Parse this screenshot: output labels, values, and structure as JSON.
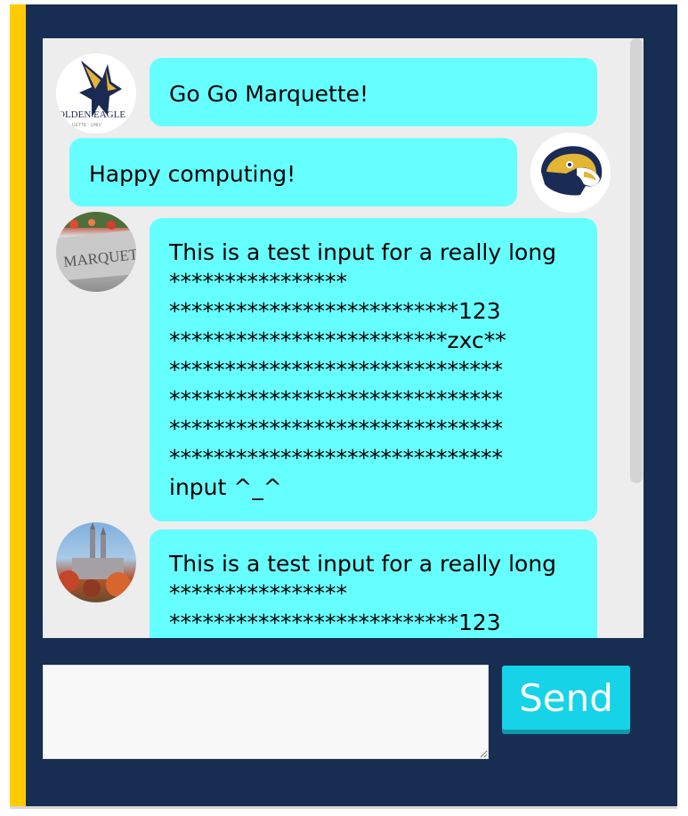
{
  "messages": [
    {
      "avatar": "golden-eagles-logo",
      "text": "Go Go Marquette!"
    },
    {
      "avatar": "eagle-mascot-logo",
      "text": "Happy computing!"
    },
    {
      "avatar": "marquette-sign-photo",
      "lines": [
        "This is a test input for a really long",
        "****************",
        "**************************123",
        "*************************zxc**",
        "******************************",
        "******************************",
        "******************************",
        "******************************",
        "input ^_^"
      ]
    },
    {
      "avatar": "campus-church-photo",
      "lines": [
        "This is a test input for a really long",
        "****************",
        "**************************123"
      ]
    }
  ],
  "input": {
    "value": ""
  },
  "send_label": "Send",
  "colors": {
    "panel": "#172e52",
    "accent_bar": "#ffcc00",
    "bubble": "#66ffff",
    "send_button": "#16d3e8"
  }
}
